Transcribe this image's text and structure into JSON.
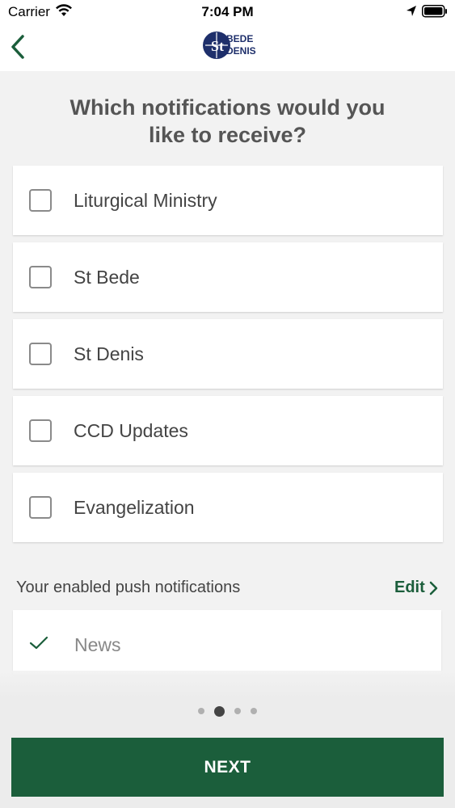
{
  "status_bar": {
    "carrier": "Carrier",
    "time": "7:04 PM"
  },
  "nav": {
    "logo_text_top": "BEDE",
    "logo_text_bottom": "DENIS",
    "logo_monogram": "St"
  },
  "question": {
    "line1": "Which notifications would you",
    "line2": "like to receive?"
  },
  "options": [
    {
      "label": "Liturgical Ministry",
      "checked": false
    },
    {
      "label": "St Bede",
      "checked": false
    },
    {
      "label": "St Denis",
      "checked": false
    },
    {
      "label": "CCD Updates",
      "checked": false
    },
    {
      "label": "Evangelization",
      "checked": false
    }
  ],
  "enabled": {
    "header": "Your enabled push notifications",
    "edit_label": "Edit",
    "items": [
      {
        "label": "News"
      }
    ]
  },
  "pagination": {
    "total": 4,
    "current": 2
  },
  "next_button": {
    "label": "NEXT"
  },
  "colors": {
    "brand_green": "#1b5e3b",
    "background": "#f2f2f2"
  }
}
